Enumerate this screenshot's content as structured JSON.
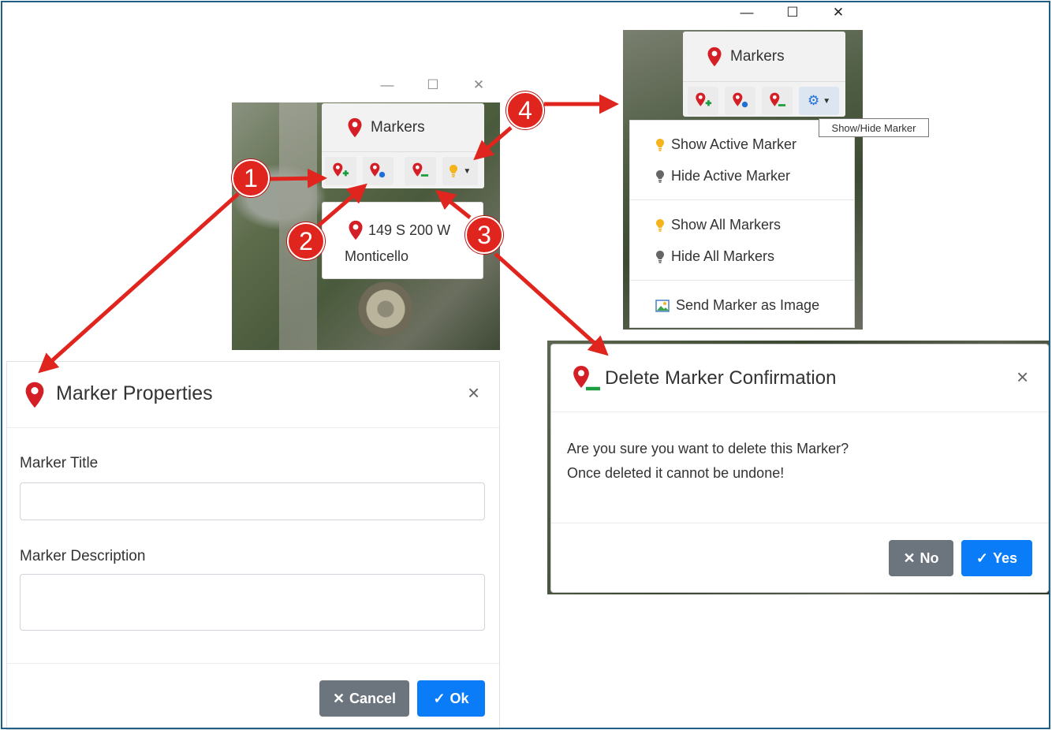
{
  "window_controls": {
    "minimize": "—",
    "maximize": "☐",
    "close": "✕"
  },
  "markers_panel": {
    "title": "Markers",
    "address_line1": "149 S 200 W",
    "address_line2": "Monticello"
  },
  "markers_menu": {
    "title": "Markers",
    "tooltip": "Show/Hide Marker",
    "items": [
      {
        "label": "Show Active Marker"
      },
      {
        "label": "Hide Active Marker"
      },
      {
        "label": "Show All Markers"
      },
      {
        "label": "Hide All Markers"
      },
      {
        "label": "Send Marker as Image"
      }
    ]
  },
  "marker_properties": {
    "title": "Marker Properties",
    "title_label": "Marker Title",
    "title_value": "",
    "description_label": "Marker Description",
    "description_value": "",
    "cancel_label": "Cancel",
    "ok_label": "Ok",
    "close": "×"
  },
  "delete_confirm": {
    "title": "Delete Marker Confirmation",
    "line1": "Are you sure you want to delete this Marker?",
    "line2": "Once deleted it cannot be undone!",
    "no_label": "No",
    "yes_label": "Yes",
    "close": "×"
  },
  "callouts": [
    "1",
    "2",
    "3",
    "4"
  ],
  "colors": {
    "marker_red": "#d41f26",
    "primary": "#0a7cf7",
    "secondary": "#6c757d",
    "bulb_on": "#f5b41b",
    "bulb_off": "#666666",
    "callout": "#e0251f"
  }
}
